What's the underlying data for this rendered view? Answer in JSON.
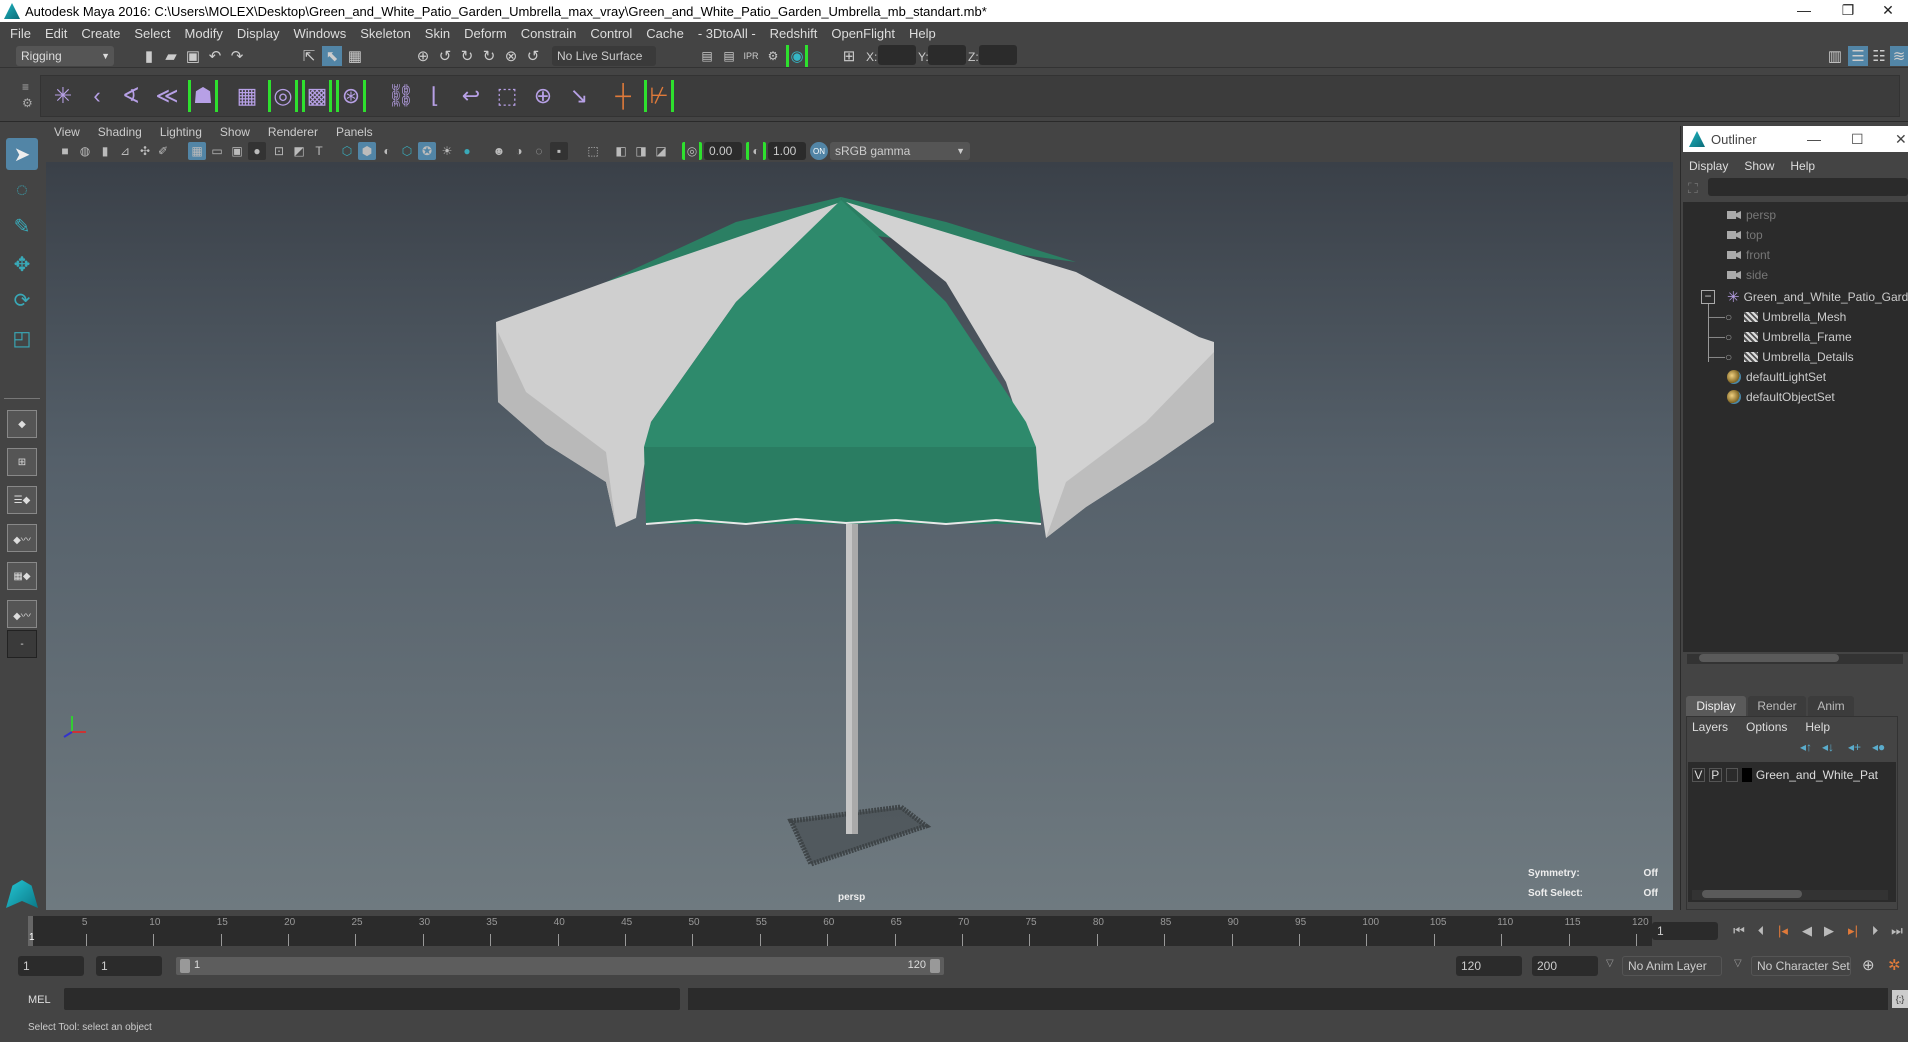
{
  "window": {
    "title": "Autodesk Maya 2016: C:\\Users\\MOLEX\\Desktop\\Green_and_White_Patio_Garden_Umbrella_max_vray\\Green_and_White_Patio_Garden_Umbrella_mb_standart.mb*",
    "minimize": "—",
    "restore": "❐",
    "close": "✕"
  },
  "menubar": [
    "File",
    "Edit",
    "Create",
    "Select",
    "Modify",
    "Display",
    "Windows",
    "Skeleton",
    "Skin",
    "Deform",
    "Constrain",
    "Control",
    "Cache",
    "- 3DtoAll -",
    "Redshift",
    "OpenFlight",
    "Help"
  ],
  "statusline": {
    "menuset": "Rigging",
    "live_surface": "No Live Surface",
    "x_label": "X:",
    "y_label": "Y:",
    "z_label": "Z:",
    "x_value": "",
    "y_value": "",
    "z_value": ""
  },
  "shelf_icons": [
    "joint-tool",
    "ik-handle",
    "ik-spline",
    "create-ik",
    "hik-skeleton",
    "paint-weights",
    "bind-skin",
    "lattice",
    "cluster",
    "parent-constraint",
    "point-constraint",
    "orient-constraint",
    "scale-constraint",
    "aim-constraint",
    "pole-vector",
    "ortho-axis",
    "ortho-key"
  ],
  "toolbox": [
    "select-tool",
    "lasso-tool",
    "paint-select-tool",
    "move-tool",
    "rotate-tool",
    "scale-tool"
  ],
  "panel": {
    "menus": [
      "View",
      "Shading",
      "Lighting",
      "Show",
      "Renderer",
      "Panels"
    ],
    "exposure": "0.00",
    "gamma": "1.00",
    "color_space": "sRGB gamma",
    "camera_label": "persp"
  },
  "hud": {
    "symmetry_label": "Symmetry:",
    "symmetry_value": "Off",
    "soft_select_label": "Soft Select:",
    "soft_select_value": "Off"
  },
  "outliner": {
    "title": "Outliner",
    "menus": [
      "Display",
      "Show",
      "Help"
    ],
    "search_placeholder": "",
    "items": [
      {
        "label": "persp",
        "type": "camera",
        "dim": true
      },
      {
        "label": "top",
        "type": "camera",
        "dim": true
      },
      {
        "label": "front",
        "type": "camera",
        "dim": true
      },
      {
        "label": "side",
        "type": "camera",
        "dim": true
      },
      {
        "label": "Green_and_White_Patio_Garden",
        "type": "group",
        "expanded": true
      },
      {
        "label": "Umbrella_Mesh",
        "type": "mesh",
        "child": true
      },
      {
        "label": "Umbrella_Frame",
        "type": "mesh",
        "child": true
      },
      {
        "label": "Umbrella_Details",
        "type": "mesh",
        "child": true
      },
      {
        "label": "defaultLightSet",
        "type": "set"
      },
      {
        "label": "defaultObjectSet",
        "type": "set"
      }
    ]
  },
  "layers": {
    "tabs": [
      "Display",
      "Render",
      "Anim"
    ],
    "active_tab": "Display",
    "menus": [
      "Layers",
      "Options",
      "Help"
    ],
    "rows": [
      {
        "v": "V",
        "p": "P",
        "color": "#000000",
        "name": "Green_and_White_Pat"
      }
    ]
  },
  "timeline": {
    "start": 1,
    "end": 120,
    "current_frame": "1",
    "tick_labels": [
      "5",
      "10",
      "15",
      "20",
      "25",
      "30",
      "35",
      "40",
      "45",
      "50",
      "55",
      "60",
      "65",
      "70",
      "75",
      "80",
      "85",
      "90",
      "95",
      "100",
      "105",
      "110",
      "115",
      "120"
    ],
    "current_label": "1"
  },
  "range": {
    "anim_start": "1",
    "play_start": "1",
    "slider_start": "1",
    "slider_end": "120",
    "play_end": "120",
    "anim_end": "200",
    "anim_layer": "No Anim Layer",
    "character_set": "No Character Set"
  },
  "mel": {
    "label": "MEL",
    "input": "",
    "result": ""
  },
  "help_line": "Select Tool: select an object",
  "colors": {
    "accent": "#5285a6",
    "canopy_green": "#2e8a6c",
    "canopy_white": "#d6d6d6",
    "key": "#e07a3a"
  }
}
